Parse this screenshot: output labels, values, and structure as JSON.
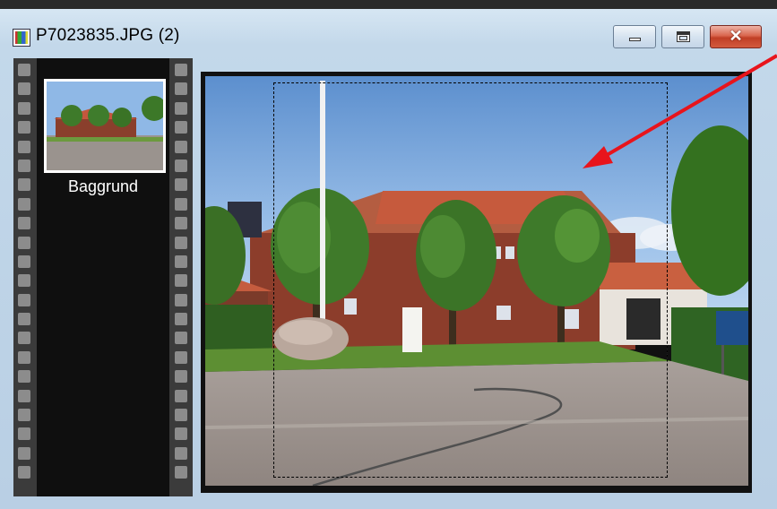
{
  "window": {
    "title": "P7023835.JPG (2)"
  },
  "controls": {
    "minimize": "",
    "maximize": "",
    "close": "✕"
  },
  "layers": [
    {
      "name": "Baggrund"
    }
  ],
  "colors": {
    "annotation_arrow": "#e8141c",
    "selection": "#ffffff",
    "film": "#0f0f0f"
  },
  "icons": {
    "app": "app-icon",
    "arrow": "red-arrow-annotation"
  }
}
